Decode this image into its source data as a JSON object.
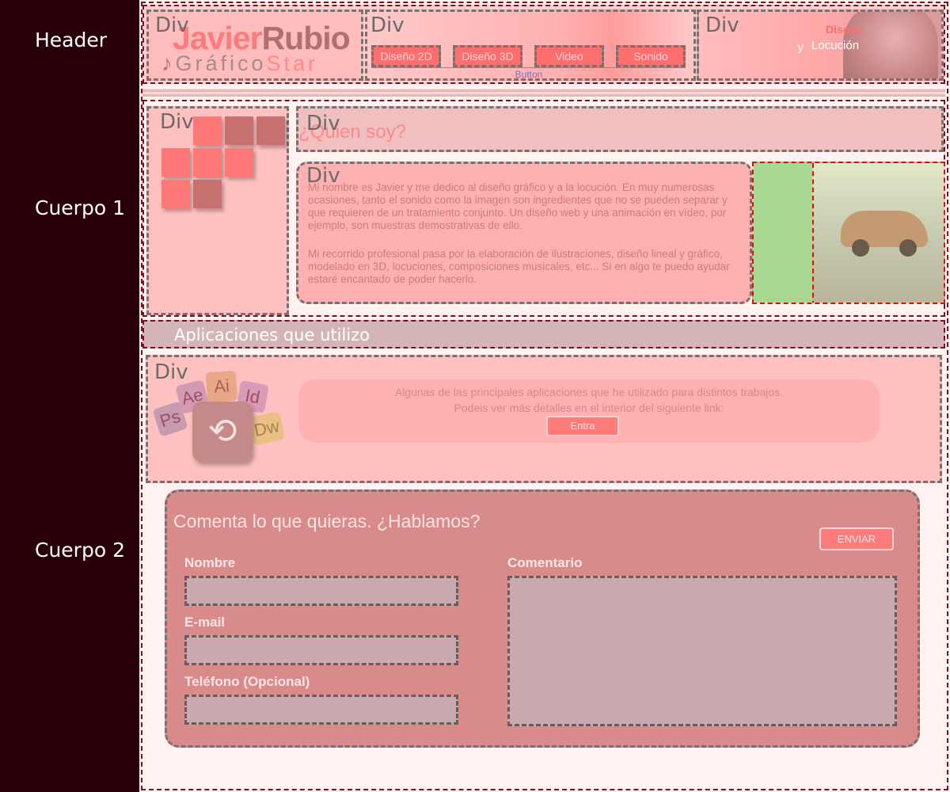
{
  "sidebar": {
    "labels": [
      "Header",
      "Cuerpo 1",
      "Cuerpo 2"
    ]
  },
  "div_tag": "Div",
  "logo": {
    "name_first": "Javier",
    "name_last": "Rubio",
    "sub_first": "Gráfico",
    "sub_second": "Star"
  },
  "nav": {
    "items": [
      "Diseño 2D",
      "Diseño 3D",
      "Video",
      "Sonido"
    ],
    "caption": "Button"
  },
  "header_right": {
    "word1": "Diseño",
    "word2": "y",
    "word3": "Locución"
  },
  "about": {
    "title": "¿Quien soy?",
    "paragraph1": "Mi nombre es Javier y me dedico al diseño gráfico y a la locución. En muy numerosas ocasiones, tanto el sonido como la imagen son ingredientes que no se pueden separar y que requieren de un tratamiento conjunto. Un diseño web y una animación en vídeo, por ejemplo, son muestras demostrativas de ello.",
    "paragraph2": "Mi recorrido profesional pasa por la elaboración de ilustraciones, diseño lineal y gráfico, modelado en 3D, locuciones, composiciones musicales, etc... Si en algo te puedo ayudar estaré encantado de poder hacerlo."
  },
  "apps": {
    "heading": "Aplicaciones que utilizo",
    "line1": "Algunas de las principales aplicaciones que he utilizado para distintos trabajos.",
    "line2": "Podeis ver más detalles en el interior del siguiente link:",
    "button": "Entra",
    "icons": [
      "Ps",
      "Ae",
      "Ai",
      "Id",
      "Dw"
    ]
  },
  "form": {
    "title": "Comenta lo que quieras. ¿Hablamos?",
    "send": "ENVIAR",
    "name_label": "Nombre",
    "email_label": "E-mail",
    "phone_label": "Teléfono (Opcional)",
    "comment_label": "Comentario"
  },
  "colors": {
    "sidebar": "#2a0008",
    "accent": "#ff6e6e",
    "form_bg": "#d98b8b"
  }
}
